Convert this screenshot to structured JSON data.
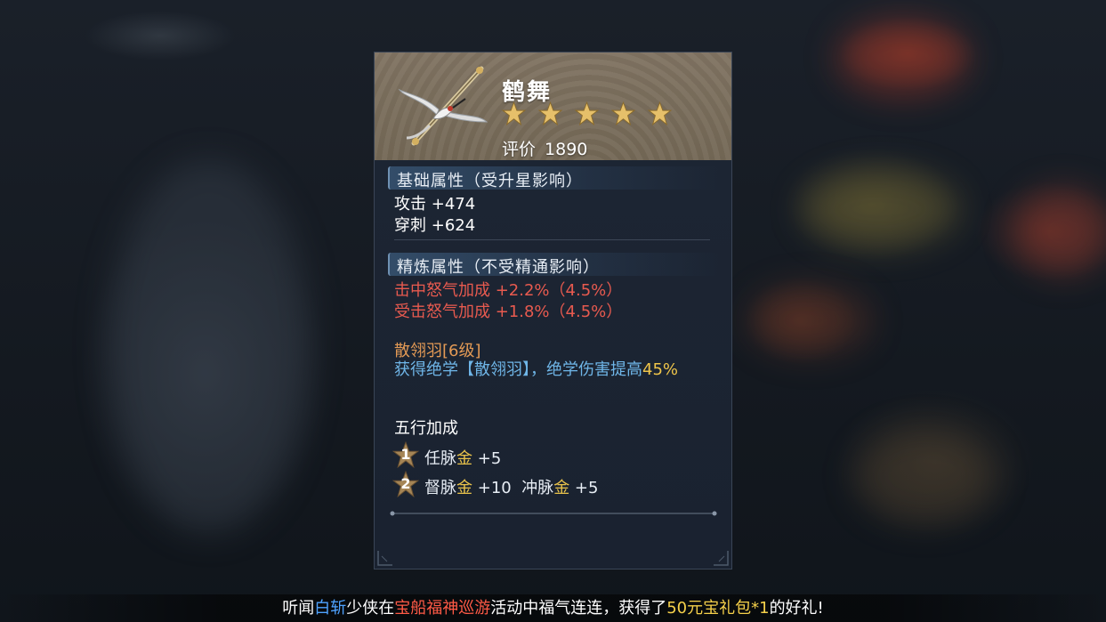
{
  "item": {
    "name": "鹤舞",
    "star_count": 5,
    "rating_label": "评价",
    "rating_value": "1890",
    "icon": "crane-weapon-icon"
  },
  "base_section": {
    "title": "基础属性（受升星影响）",
    "stats": [
      {
        "label": "攻击",
        "value": "+474"
      },
      {
        "label": "穿刺",
        "value": "+624"
      }
    ]
  },
  "refine_section": {
    "title": "精炼属性（不受精通影响）",
    "stats": [
      {
        "text": "击中怒气加成 +2.2%（4.5%）"
      },
      {
        "text": "受击怒气加成 +1.8%（4.5%）"
      }
    ]
  },
  "skill": {
    "name": "散翎羽[6级]",
    "desc_prefix": "获得绝学【散翎羽】，绝学伤害提高",
    "desc_value": "45%"
  },
  "five_elements": {
    "title": "五行加成",
    "rows": [
      {
        "badge": "1",
        "items": [
          {
            "name": "任脉",
            "element": "金",
            "bonus": "+5"
          }
        ]
      },
      {
        "badge": "2",
        "items": [
          {
            "name": "督脉",
            "element": "金",
            "bonus": "+10"
          },
          {
            "name": "冲脉",
            "element": "金",
            "bonus": "+5"
          }
        ]
      }
    ]
  },
  "broadcast": {
    "p1": "听闻",
    "player": "白斩",
    "p2": "少侠在",
    "event": "宝船福神巡游",
    "p3": "活动中福气连连，获得了",
    "reward": "50元宝礼包*1",
    "p4": "的好礼!"
  },
  "colors": {
    "star_gold": "#e6c06a",
    "red_stat": "#e85a4f",
    "skill_orange": "#e39a55",
    "skill_blue": "#6fb6e8",
    "highlight_yellow": "#f0c64a"
  }
}
